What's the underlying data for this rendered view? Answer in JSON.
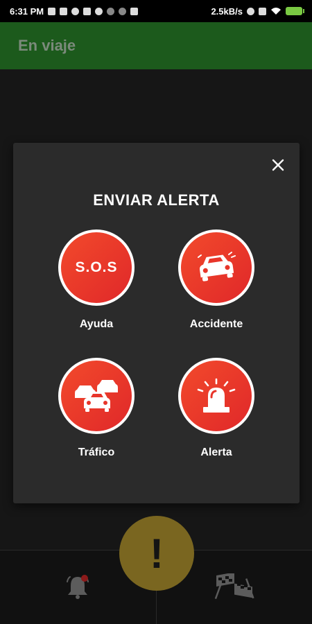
{
  "status_bar": {
    "time": "6:31 PM",
    "network_speed": "2.5kB/s"
  },
  "app_bar": {
    "title": "En viaje"
  },
  "dialog": {
    "title": "ENVIAR ALERTA",
    "close_icon": "close-icon",
    "options": [
      {
        "label": "Ayuda",
        "icon": "sos-icon",
        "icon_text": "S.O.S"
      },
      {
        "label": "Accidente",
        "icon": "car-crash-icon"
      },
      {
        "label": "Tráfico",
        "icon": "traffic-cars-icon"
      },
      {
        "label": "Alerta",
        "icon": "siren-icon"
      }
    ]
  },
  "fab": {
    "symbol": "!"
  },
  "bottom_nav": {
    "left_icon": "notification-bell-icon",
    "right_icon": "checkered-flags-icon"
  },
  "colors": {
    "app_bar": "#1c5a1c",
    "dialog_bg": "#2b2b2b",
    "alert_red": "#e8352a",
    "fab": "#7a6620"
  }
}
